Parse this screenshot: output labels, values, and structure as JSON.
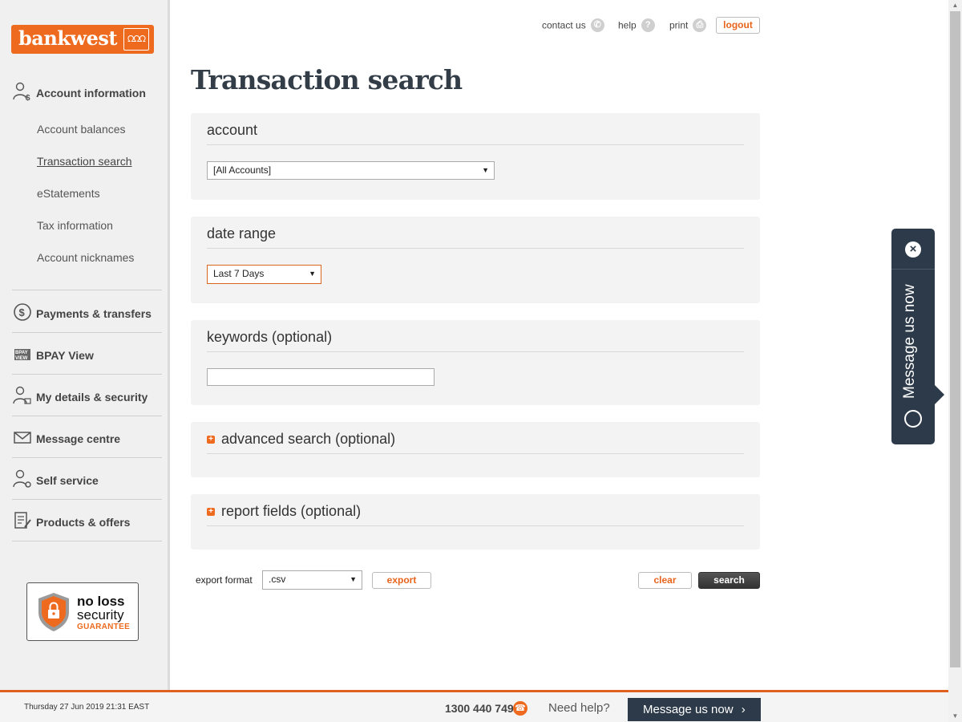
{
  "brand": {
    "name": "bankwest",
    "mark": "ᘯᘯᘯ"
  },
  "sidebar": {
    "sections": [
      {
        "label": "Account information",
        "icon": "user-dollar-icon"
      },
      {
        "label": "Payments & transfers",
        "icon": "dollar-arrows-icon"
      },
      {
        "label": "BPAY View",
        "icon": "bpay-view-icon"
      },
      {
        "label": "My details & security",
        "icon": "user-lock-icon"
      },
      {
        "label": "Message centre",
        "icon": "envelope-icon"
      },
      {
        "label": "Self service",
        "icon": "user-gear-icon"
      },
      {
        "label": "Products & offers",
        "icon": "document-pencil-icon"
      }
    ],
    "sub_items": [
      {
        "label": "Account balances"
      },
      {
        "label": "Transaction search"
      },
      {
        "label": "eStatements"
      },
      {
        "label": "Tax information"
      },
      {
        "label": "Account nicknames"
      }
    ],
    "guarantee": {
      "line1": "no loss",
      "line2": "security",
      "line3": "GUARANTEE"
    }
  },
  "header": {
    "contact_label": "contact us",
    "help_label": "help",
    "print_label": "print",
    "logout_label": "logout"
  },
  "page": {
    "title": "Transaction search"
  },
  "form": {
    "account": {
      "title": "account",
      "selected": "[All Accounts]"
    },
    "date_range": {
      "title": "date range",
      "selected": "Last 7 Days"
    },
    "keywords": {
      "title": "keywords (optional)",
      "value": ""
    },
    "advanced": {
      "title": "advanced search (optional)"
    },
    "report": {
      "title": "report fields (optional)"
    }
  },
  "actions": {
    "export_format_label": "export format",
    "export_format_value": ".csv",
    "export_label": "export",
    "clear_label": "clear",
    "search_label": "search"
  },
  "widget": {
    "label": "Message us now"
  },
  "footer": {
    "datetime": "Thursday 27 Jun 2019 21:31 EAST",
    "phone": "1300 440 749",
    "need_help": "Need help?",
    "message_label": "Message us now"
  },
  "colors": {
    "accent": "#ee6a1f",
    "navy": "#2c3a4a",
    "panel": "#f3f3f3"
  }
}
